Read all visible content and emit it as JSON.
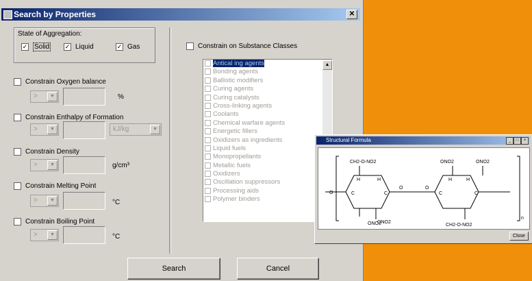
{
  "window": {
    "title": "Search by Properties"
  },
  "aggregation": {
    "label": "State of Aggregation:",
    "solid": "Solid",
    "liquid": "Liquid",
    "gas": "Gas"
  },
  "oxygen": {
    "label": "Constrain Oxygen balance",
    "operator": ">",
    "unit": "%"
  },
  "enthalpy": {
    "label": "Constrain Enthalpy of Formation",
    "operator": ">",
    "unit": "kJ/kg"
  },
  "density": {
    "label": "Constrain Density",
    "operator": ">",
    "unit": "g/cm³"
  },
  "melting": {
    "label": "Constrain Melting Point",
    "operator": ">",
    "unit": "°C"
  },
  "boiling": {
    "label": "Constrain Boiling Point",
    "operator": ">",
    "unit": "°C"
  },
  "classes": {
    "label": "Constrain on Substance Classes",
    "items": [
      "Antical ing agents",
      "Bonding agents",
      "Ballistic modifiers",
      "Curing agents",
      "Curing catalysts",
      "Cross-linking agents",
      "Coolants",
      "Chemical warfare agents",
      "Energetic fillers",
      "Oxidizers as ingredients",
      "Liquid fuels",
      "Monopropellants",
      "Metallic fuels",
      "Oxidizers",
      "Oscillation suppressors",
      "Processing aids",
      "Polymer binders"
    ]
  },
  "buttons": {
    "search": "Search",
    "cancel": "Cancel"
  },
  "structure": {
    "title": "Structural Formula",
    "ok": "Close",
    "labels": [
      "CH2-O-NO2",
      "ONO2",
      "ONO2",
      "ONO2",
      "CH2-O-NO2",
      "ONO2",
      "O",
      "O",
      "O",
      "H",
      "H",
      "H",
      "H",
      "C",
      "C",
      "C",
      "C",
      "n"
    ]
  }
}
